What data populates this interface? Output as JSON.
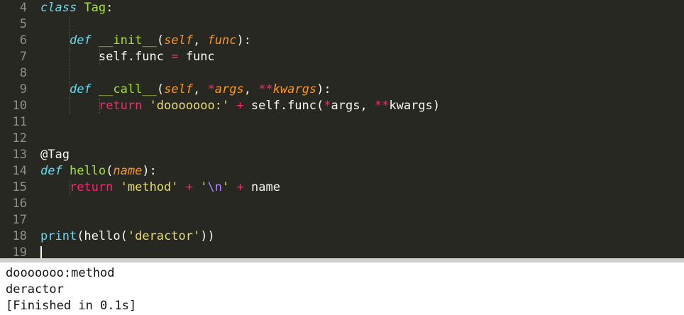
{
  "editor": {
    "lines": [
      {
        "num": "4",
        "tokens": [
          {
            "t": "class",
            "c": "kw-def"
          },
          {
            "t": " ",
            "c": "plain"
          },
          {
            "t": "Tag",
            "c": "name-cls"
          },
          {
            "t": ":",
            "c": "plain"
          }
        ]
      },
      {
        "num": "5",
        "tokens": []
      },
      {
        "num": "6",
        "tokens": [
          {
            "t": "    ",
            "c": "plain"
          },
          {
            "t": "def",
            "c": "kw-def"
          },
          {
            "t": " ",
            "c": "plain"
          },
          {
            "t": "__init__",
            "c": "name-fn"
          },
          {
            "t": "(",
            "c": "plain"
          },
          {
            "t": "self",
            "c": "param"
          },
          {
            "t": ", ",
            "c": "plain"
          },
          {
            "t": "func",
            "c": "param"
          },
          {
            "t": "):",
            "c": "plain"
          }
        ]
      },
      {
        "num": "7",
        "tokens": [
          {
            "t": "        self.func ",
            "c": "plain"
          },
          {
            "t": "=",
            "c": "op"
          },
          {
            "t": " func",
            "c": "plain"
          }
        ]
      },
      {
        "num": "8",
        "tokens": []
      },
      {
        "num": "9",
        "tokens": [
          {
            "t": "    ",
            "c": "plain"
          },
          {
            "t": "def",
            "c": "kw-def"
          },
          {
            "t": " ",
            "c": "plain"
          },
          {
            "t": "__call__",
            "c": "name-fn"
          },
          {
            "t": "(",
            "c": "plain"
          },
          {
            "t": "self",
            "c": "param"
          },
          {
            "t": ", ",
            "c": "plain"
          },
          {
            "t": "*",
            "c": "op"
          },
          {
            "t": "args",
            "c": "param"
          },
          {
            "t": ", ",
            "c": "plain"
          },
          {
            "t": "**",
            "c": "op"
          },
          {
            "t": "kwargs",
            "c": "param"
          },
          {
            "t": "):",
            "c": "plain"
          }
        ]
      },
      {
        "num": "10",
        "tokens": [
          {
            "t": "        ",
            "c": "plain"
          },
          {
            "t": "return",
            "c": "kw-ret"
          },
          {
            "t": " ",
            "c": "plain"
          },
          {
            "t": "'dooooooo:'",
            "c": "str"
          },
          {
            "t": " ",
            "c": "plain"
          },
          {
            "t": "+",
            "c": "op"
          },
          {
            "t": " self.func(",
            "c": "plain"
          },
          {
            "t": "*",
            "c": "op"
          },
          {
            "t": "args, ",
            "c": "plain"
          },
          {
            "t": "**",
            "c": "op"
          },
          {
            "t": "kwargs)",
            "c": "plain"
          }
        ]
      },
      {
        "num": "11",
        "tokens": []
      },
      {
        "num": "12",
        "tokens": []
      },
      {
        "num": "13",
        "tokens": [
          {
            "t": "@Tag",
            "c": "plain"
          }
        ]
      },
      {
        "num": "14",
        "tokens": [
          {
            "t": "def",
            "c": "kw-def"
          },
          {
            "t": " ",
            "c": "plain"
          },
          {
            "t": "hello",
            "c": "name-fn"
          },
          {
            "t": "(",
            "c": "plain"
          },
          {
            "t": "name",
            "c": "param"
          },
          {
            "t": "):",
            "c": "plain"
          }
        ]
      },
      {
        "num": "15",
        "tokens": [
          {
            "t": "    ",
            "c": "plain"
          },
          {
            "t": "return",
            "c": "kw-ret"
          },
          {
            "t": " ",
            "c": "plain"
          },
          {
            "t": "'method'",
            "c": "str"
          },
          {
            "t": " ",
            "c": "plain"
          },
          {
            "t": "+",
            "c": "op"
          },
          {
            "t": " ",
            "c": "plain"
          },
          {
            "t": "'",
            "c": "str"
          },
          {
            "t": "\\n",
            "c": "esc"
          },
          {
            "t": "'",
            "c": "str"
          },
          {
            "t": " ",
            "c": "plain"
          },
          {
            "t": "+",
            "c": "op"
          },
          {
            "t": " name",
            "c": "plain"
          }
        ]
      },
      {
        "num": "16",
        "tokens": []
      },
      {
        "num": "17",
        "tokens": []
      },
      {
        "num": "18",
        "tokens": [
          {
            "t": "print",
            "c": "builtin"
          },
          {
            "t": "(hello(",
            "c": "plain"
          },
          {
            "t": "'deractor'",
            "c": "str"
          },
          {
            "t": "))",
            "c": "plain"
          }
        ]
      },
      {
        "num": "19",
        "tokens": []
      }
    ]
  },
  "output": {
    "lines": [
      "dooooooo:method",
      "deractor",
      "[Finished in 0.1s]"
    ]
  },
  "colors": {
    "editor_bg": "#272822",
    "output_bg": "#ffffff",
    "keyword_def": "#66d9ef",
    "function_name": "#a6e22e",
    "parameter": "#fd971f",
    "operator": "#f92672",
    "string": "#e6db74",
    "escape": "#ae81ff"
  }
}
